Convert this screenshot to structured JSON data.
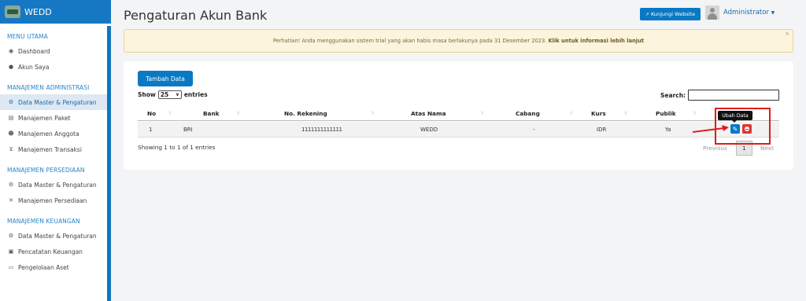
{
  "app": {
    "name": "WEDD"
  },
  "sidebar": {
    "sections": [
      {
        "title": "MENU UTAMA",
        "items": [
          {
            "label": "Dashboard",
            "icon": "dashboard-icon"
          },
          {
            "label": "Akun Saya",
            "icon": "user-icon"
          }
        ]
      },
      {
        "title": "MANAJEMEN ADMINISTRASI",
        "items": [
          {
            "label": "Data Master & Pengaturan",
            "icon": "cogs-icon",
            "active": true
          },
          {
            "label": "Manajemen Paket",
            "icon": "book-icon"
          },
          {
            "label": "Manajemen Anggota",
            "icon": "users-icon"
          },
          {
            "label": "Manajemen Transaksi",
            "icon": "cart-icon"
          }
        ]
      },
      {
        "title": "MANAJEMEN PERSEDIAAN",
        "items": [
          {
            "label": "Data Master & Pengaturan",
            "icon": "cogs-icon"
          },
          {
            "label": "Manajemen Persediaan",
            "icon": "tools-icon"
          }
        ]
      },
      {
        "title": "MANAJEMEN KEUANGAN",
        "items": [
          {
            "label": "Data Master & Pengaturan",
            "icon": "cogs-icon"
          },
          {
            "label": "Pencatatan Keuangan",
            "icon": "money-icon"
          },
          {
            "label": "Pengelolaan Aset",
            "icon": "laptop-icon"
          }
        ]
      }
    ]
  },
  "header": {
    "title": "Pengaturan Akun Bank",
    "website_button": "Kunjungi Website",
    "user_name": "Administrator"
  },
  "alert": {
    "text": "Perhatian! Anda menggunakan sistem trial yang akan habis masa berlakunya pada 31 Desember 2023.",
    "link": "Klik untuk informasi lebih lanjut",
    "close": "×"
  },
  "table_controls": {
    "add_button": "Tambah Data",
    "show_label": "Show",
    "show_value": "25",
    "entries_label": "entries",
    "search_label": "Search:",
    "search_value": ""
  },
  "table": {
    "columns": [
      "No",
      "Bank",
      "No. Rekening",
      "Atas Nama",
      "Cabang",
      "Kurs",
      "Publik",
      ""
    ],
    "rows": [
      {
        "no": "1",
        "bank": "BRI",
        "rekening": "1111111111111",
        "atas_nama": "WEDD",
        "cabang": "-",
        "kurs": "IDR",
        "publik": "Ya"
      }
    ],
    "info": "Showing 1 to 1 of 1 entries",
    "pagination": {
      "previous": "Previous",
      "current": "1",
      "next": "Next"
    }
  },
  "actions": {
    "edit_tooltip": "Ubah Data"
  },
  "colors": {
    "primary": "#0a79c4",
    "danger": "#e3342f",
    "annotation": "#e01b1b",
    "alert_bg": "#fcf4dc"
  }
}
